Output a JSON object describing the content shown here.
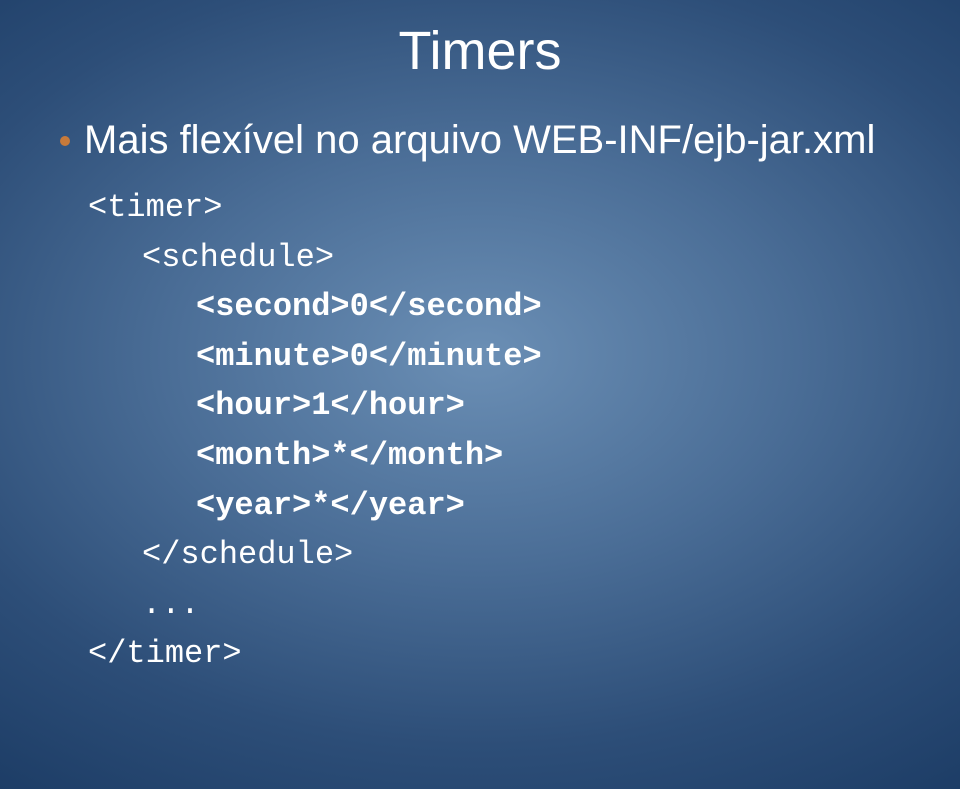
{
  "title": "Timers",
  "bullet": "Mais flexível no arquivo WEB-INF/ejb-jar.xml",
  "code": {
    "timer_open": "<timer>",
    "schedule_open": "<schedule>",
    "second": "<second>0</second>",
    "minute": "<minute>0</minute>",
    "hour": "<hour>1</hour>",
    "month": "<month>*</month>",
    "year": "<year>*</year>",
    "schedule_close": "</schedule>",
    "ellipsis": "...",
    "timer_close": "</timer>"
  }
}
